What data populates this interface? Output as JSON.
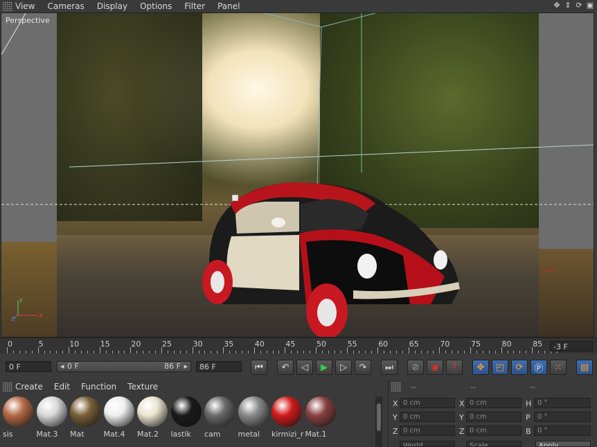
{
  "menu": {
    "items": [
      "View",
      "Cameras",
      "Display",
      "Options",
      "Filter",
      "Panel"
    ]
  },
  "viewport": {
    "label": "Perspective"
  },
  "timeline": {
    "ticks": [
      "0",
      "5",
      "10",
      "15",
      "20",
      "25",
      "30",
      "35",
      "40",
      "45",
      "50",
      "55",
      "60",
      "65",
      "70",
      "75",
      "80",
      "85"
    ],
    "current_frame": "-3 F"
  },
  "transport": {
    "start_field": "0 F",
    "range_start": "0 F",
    "range_end": "86 F",
    "end_field": "86 F"
  },
  "materials": {
    "menu": [
      "Create",
      "Edit",
      "Function",
      "Texture"
    ],
    "items": [
      {
        "name": "sis",
        "color": "#b56a45"
      },
      {
        "name": "Mat.3",
        "color": "#d8d8d8"
      },
      {
        "name": "Mat",
        "color": "#7a6038"
      },
      {
        "name": "Mat.4",
        "color": "#eeeeee"
      },
      {
        "name": "Mat.2",
        "color": "#e8e4d0"
      },
      {
        "name": "lastik",
        "color": "#1a1a1a"
      },
      {
        "name": "cam",
        "color": "#6a6a6a"
      },
      {
        "name": "metal",
        "color": "#8a8a8a"
      },
      {
        "name": "kirmizi_r",
        "color": "#d11a1a"
      },
      {
        "name": "Mat.1",
        "color": "#8a4040"
      }
    ]
  },
  "coordinates": {
    "headers": [
      "--",
      "--",
      "--"
    ],
    "rows": [
      {
        "a": "X",
        "av": "0 cm",
        "b": "X",
        "bv": "0 cm",
        "c": "H",
        "cv": "0 °"
      },
      {
        "a": "Y",
        "av": "0 cm",
        "b": "Y",
        "bv": "0 cm",
        "c": "P",
        "cv": "0 °"
      },
      {
        "a": "Z",
        "av": "0 cm",
        "b": "Z",
        "bv": "0 cm",
        "c": "B",
        "cv": "0 °"
      }
    ],
    "mode_world": "World",
    "mode_scale": "Scale",
    "apply": "Apply"
  }
}
